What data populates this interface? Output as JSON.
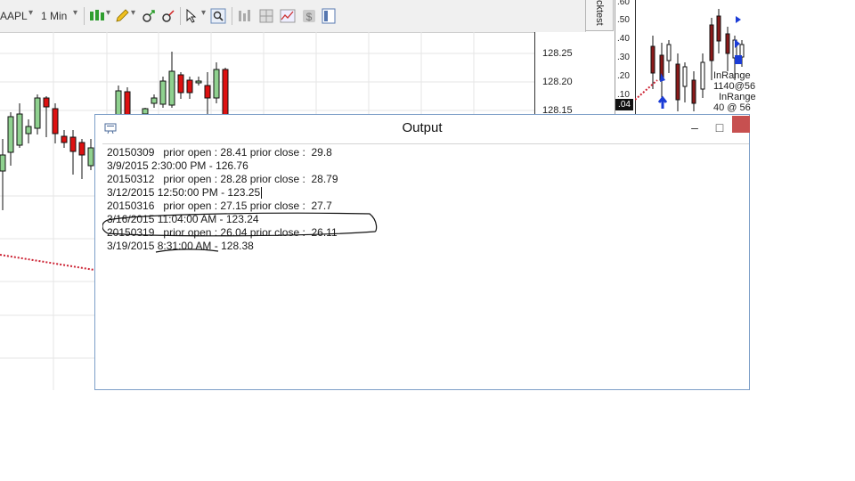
{
  "toolbar": {
    "symbol": "AAPL",
    "interval": "1 Min",
    "icons": [
      "bar-type-icon",
      "pencil-icon",
      "zoom-in-icon",
      "zoom-out-icon",
      "pointer-icon",
      "search-icon",
      "column-icon",
      "tile-icon",
      "line-chart-icon",
      "dollar-icon",
      "panel-icon"
    ]
  },
  "price_axis": {
    "labels": [
      "128.25",
      "128.20",
      "128.15"
    ]
  },
  "strategy_tab": {
    "label": "cktest"
  },
  "mini_chart": {
    "axis_labels": [
      ".60",
      ".50",
      ".40",
      ".30",
      ".20",
      ".10"
    ],
    "current_value": ".04",
    "texts": {
      "t1": "InRange",
      "t2": "1140@56",
      "t3": "InRange",
      "t4": "40 @ 56"
    }
  },
  "output": {
    "title": "Output",
    "controls": {
      "minimize": "–",
      "maximize": "□"
    },
    "lines": [
      "20150309   prior open : 28.41 prior close :  29.8",
      "3/9/2015 2:30:00 PM - 126.76",
      "20150312   prior open : 28.28 prior close :  28.79",
      "3/12/2015 12:50:00 PM - 123.25",
      "20150316   prior open : 27.15 prior close :  27.7",
      "3/16/2015 11:04:00 AM - 123.24",
      "20150319   prior open : 26.04 prior close :  26.11",
      "3/19/2015 8:31:00 AM - 128.38"
    ]
  },
  "colors": {
    "bull_candle": "#8fd18f",
    "bear_candle": "#dd1111",
    "dotted_line": "#cc2233",
    "window_border": "#7d9fc8",
    "close_button": "#c75050"
  }
}
